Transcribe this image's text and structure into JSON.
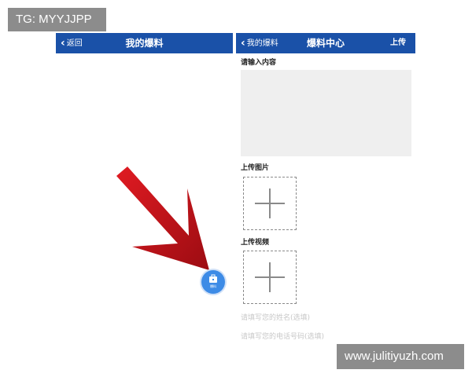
{
  "watermarks": {
    "top_left": "TG: MYYJJPP",
    "bottom_right": "www.julitiyuzh.com"
  },
  "left_screen": {
    "back_label": "返回",
    "title": "我的爆料",
    "fab_label": "爆料"
  },
  "right_screen": {
    "back_label": "我的爆料",
    "title": "爆料中心",
    "upload_label": "上传",
    "content_label": "请输入内容",
    "image_label": "上传图片",
    "video_label": "上传视频",
    "name_placeholder": "请填写您的姓名(选填)",
    "phone_placeholder": "请填写您的电话号码(选填)"
  },
  "colors": {
    "navbar": "#1a51a8",
    "arrow": "#c0141b",
    "fab": "#3d8be6"
  },
  "icons": {
    "back": "chevron-left-icon",
    "add": "plus-icon",
    "arrow": "red-arrow",
    "fab": "bag-icon"
  }
}
